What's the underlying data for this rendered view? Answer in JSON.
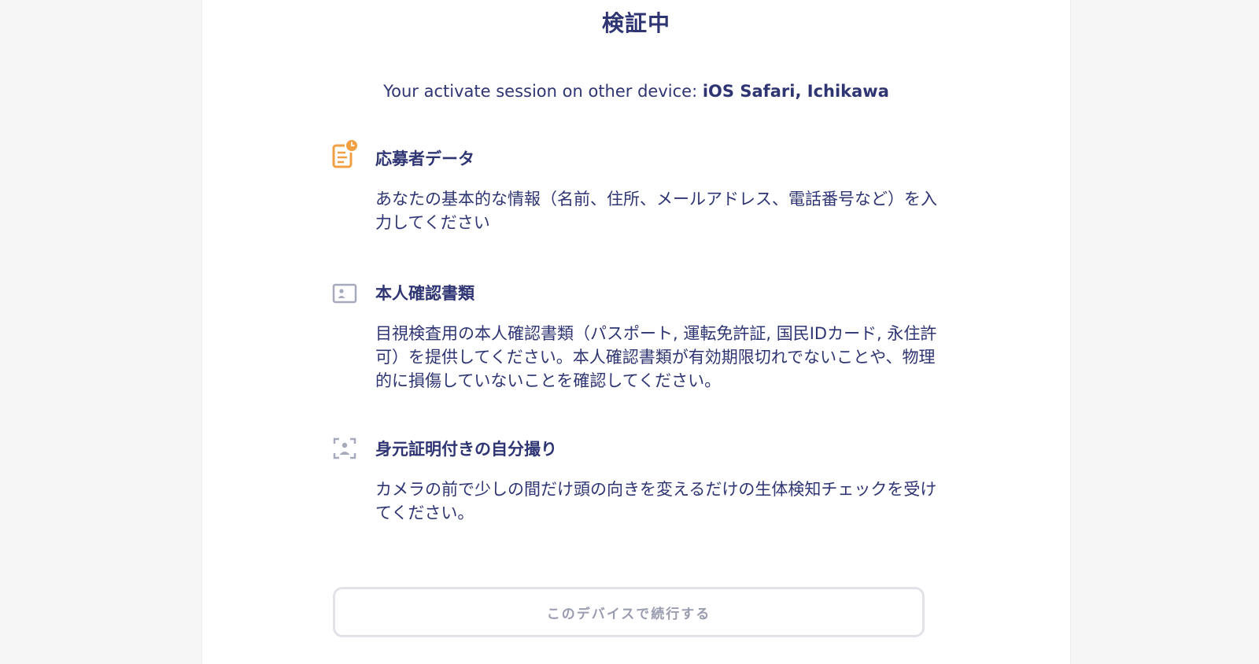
{
  "page": {
    "title": "検証中"
  },
  "session": {
    "prefix": "Your activate session on other device: ",
    "device": "iOS Safari, Ichikawa"
  },
  "steps": [
    {
      "icon": "document-clock-icon",
      "title": "応募者データ",
      "description": "あなたの基本的な情報（名前、住所、メールアドレス、電話番号など）を入力してください"
    },
    {
      "icon": "id-card-icon",
      "title": "本人確認書類",
      "description": "目視検査用の本人確認書類（パスポート, 運転免許証, 国民IDカード, 永住許可）を提供してください。本人確認書類が有効期限切れでないことや、物理的に損傷していないことを確認してください。"
    },
    {
      "icon": "face-scan-icon",
      "title": "身元証明付きの自分撮り",
      "description": "カメラの前で少しの間だけ頭の向きを変えるだけの生体検知チェックを受けてください。"
    }
  ],
  "actions": {
    "continue_label": "このデバイスで続行する"
  },
  "colors": {
    "text": "#2f3573",
    "accent": "#f0a042",
    "muted_icon": "#a7a9bd",
    "button_text": "#9a9cb0",
    "button_border": "#e2e3e8"
  }
}
